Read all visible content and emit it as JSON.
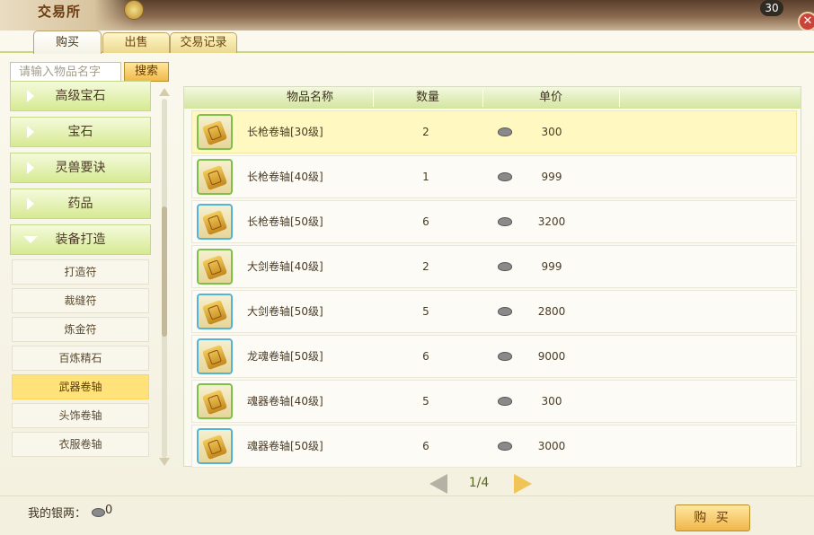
{
  "window": {
    "title": "交易所",
    "level_badge": "30",
    "close_glyph": "✕"
  },
  "tabs": [
    {
      "label": "购买",
      "active": true
    },
    {
      "label": "出售",
      "active": false
    },
    {
      "label": "交易记录",
      "active": false
    }
  ],
  "search": {
    "placeholder": "请输入物品名字",
    "button_label": "搜索"
  },
  "categories": [
    {
      "label": "高级宝石",
      "expanded": false
    },
    {
      "label": "宝石",
      "expanded": false
    },
    {
      "label": "灵兽要诀",
      "expanded": false
    },
    {
      "label": "药品",
      "expanded": false
    },
    {
      "label": "装备打造",
      "expanded": true
    }
  ],
  "subcategories": [
    {
      "label": "打造符",
      "selected": false
    },
    {
      "label": "裁缝符",
      "selected": false
    },
    {
      "label": "炼金符",
      "selected": false
    },
    {
      "label": "百炼精石",
      "selected": false
    },
    {
      "label": "武器卷轴",
      "selected": true
    },
    {
      "label": "头饰卷轴",
      "selected": false
    },
    {
      "label": "衣服卷轴",
      "selected": false
    }
  ],
  "table": {
    "headers": {
      "name": "物品名称",
      "quantity": "数量",
      "price": "单价"
    },
    "rows": [
      {
        "name": "长枪卷轴[30级]",
        "quantity": "2",
        "price": "300",
        "icon": "scroll-icon",
        "frame": "green",
        "highlighted": true
      },
      {
        "name": "长枪卷轴[40级]",
        "quantity": "1",
        "price": "999",
        "icon": "scroll-icon",
        "frame": "green",
        "highlighted": false
      },
      {
        "name": "长枪卷轴[50级]",
        "quantity": "6",
        "price": "3200",
        "icon": "scroll-icon",
        "frame": "blue",
        "highlighted": false
      },
      {
        "name": "大剑卷轴[40级]",
        "quantity": "2",
        "price": "999",
        "icon": "scroll-icon",
        "frame": "green",
        "highlighted": false
      },
      {
        "name": "大剑卷轴[50级]",
        "quantity": "5",
        "price": "2800",
        "icon": "scroll-icon",
        "frame": "blue",
        "highlighted": false
      },
      {
        "name": "龙魂卷轴[50级]",
        "quantity": "6",
        "price": "9000",
        "icon": "scroll-icon",
        "frame": "blue",
        "highlighted": false
      },
      {
        "name": "魂器卷轴[40级]",
        "quantity": "5",
        "price": "300",
        "icon": "scroll-icon",
        "frame": "green",
        "highlighted": false
      },
      {
        "name": "魂器卷轴[50级]",
        "quantity": "6",
        "price": "3000",
        "icon": "scroll-icon",
        "frame": "blue",
        "highlighted": false
      }
    ]
  },
  "pager": {
    "text": "1/4"
  },
  "footer": {
    "silver_label": "我的银两：",
    "silver_value": "0",
    "buy_button": "购 买"
  },
  "colors": {
    "accent_green": "#d6ea92",
    "selected_yellow": "#ffe37a",
    "button_gold": "#f0b64a"
  }
}
